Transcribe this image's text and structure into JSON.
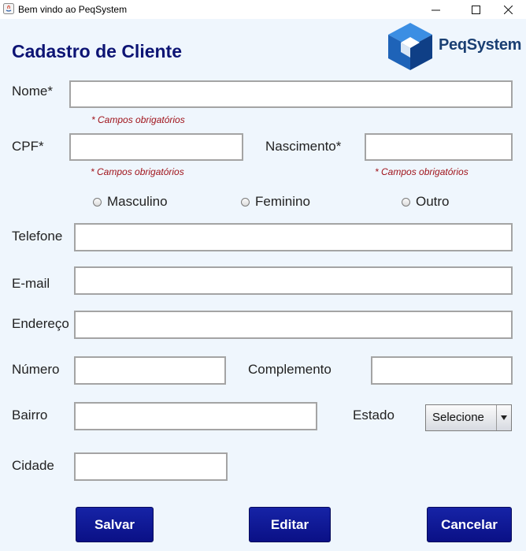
{
  "window": {
    "title": "Bem vindo ao PeqSystem"
  },
  "header": {
    "title": "Cadastro de Cliente",
    "logo_text": "PeqSystem"
  },
  "form": {
    "nome_label": "Nome*",
    "cpf_label": "CPF*",
    "nascimento_label": "Nascimento*",
    "required_note": "* Campos obrigatórios",
    "gender_options": [
      "Masculino",
      "Feminino",
      "Outro"
    ],
    "telefone_label": "Telefone",
    "email_label": "E-mail",
    "endereco_label": "Endereço",
    "numero_label": "Número",
    "complemento_label": "Complemento",
    "bairro_label": "Bairro",
    "estado_label": "Estado",
    "estado_value": "Selecione",
    "cidade_label": "Cidade"
  },
  "buttons": {
    "save": "Salvar",
    "edit": "Editar",
    "cancel": "Cancelar"
  },
  "colors": {
    "title": "#0d1474",
    "button": "#0f1896",
    "required": "#a0131b",
    "logo_blue": "#1d67c2"
  }
}
